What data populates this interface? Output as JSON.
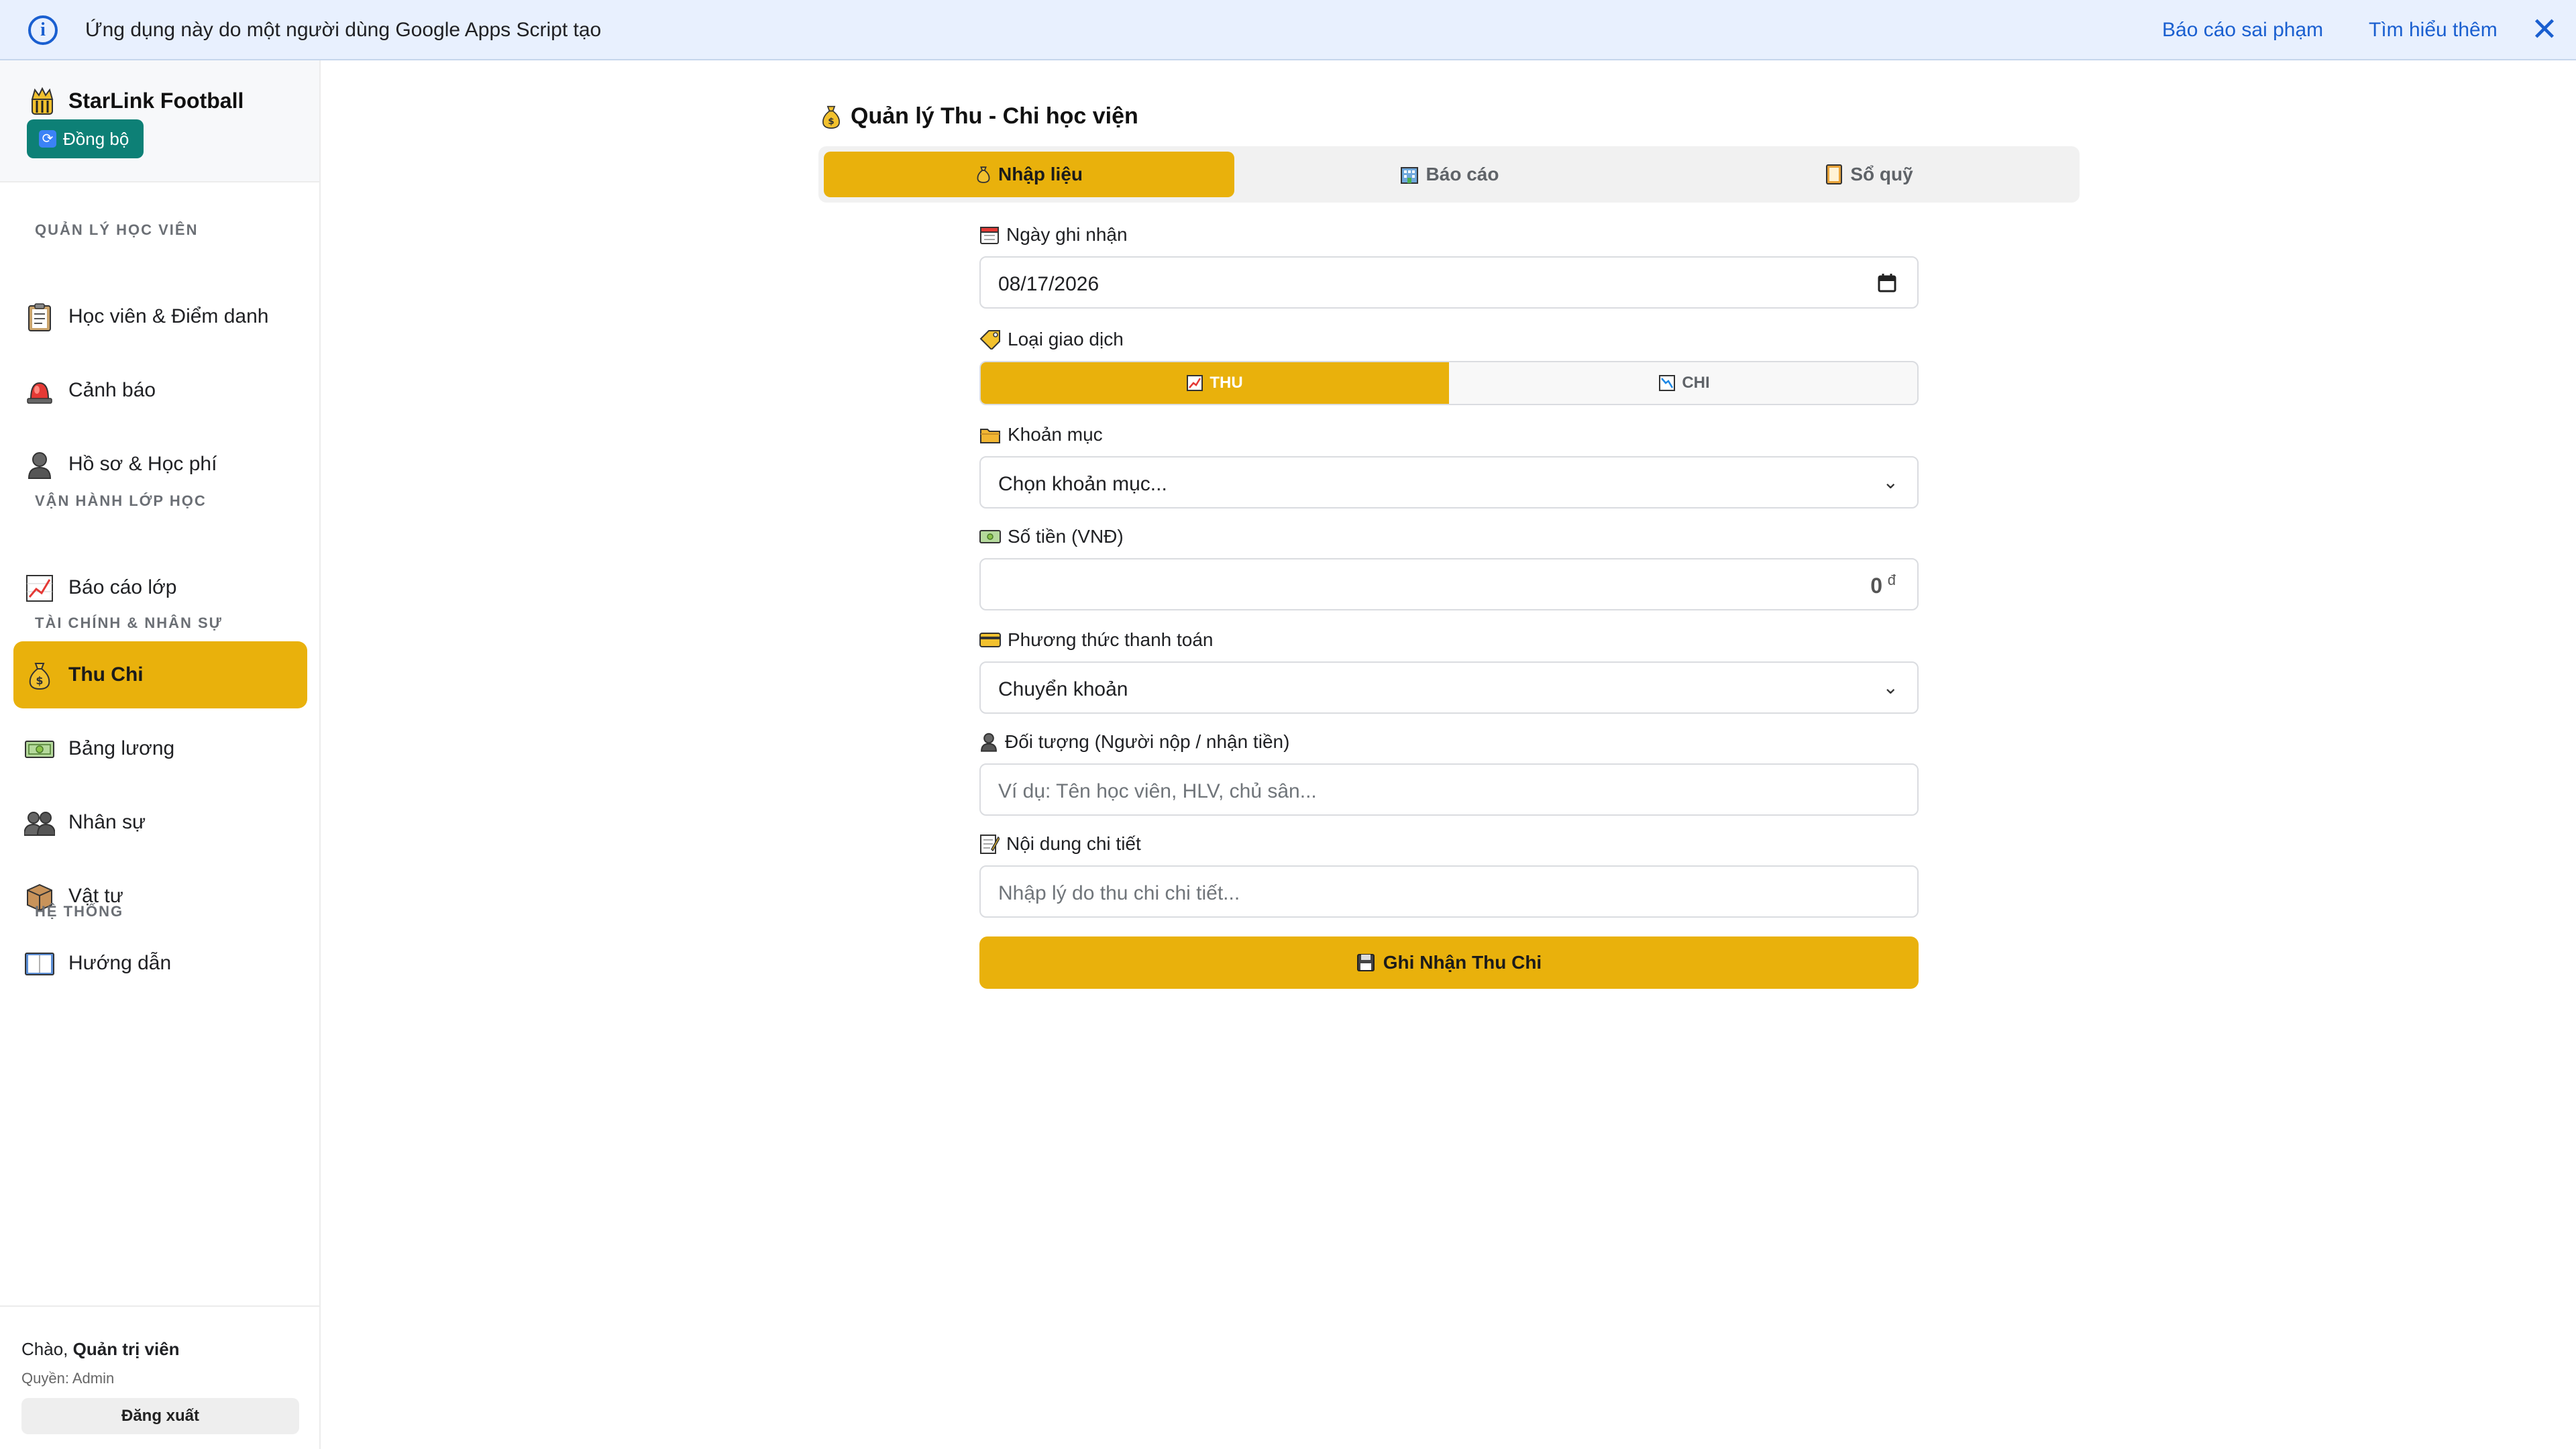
{
  "banner": {
    "text": "Ứng dụng này do một người dùng Google Apps Script tạo",
    "report_link": "Báo cáo sai phạm",
    "learn_link": "Tìm hiểu thêm",
    "info_glyph": "i",
    "close_glyph": "✕"
  },
  "sidebar": {
    "brand_name": "StarLink Football",
    "sync_label": "Đồng bộ",
    "sections": {
      "students": "QUẢN LÝ HỌC VIÊN",
      "operations": "VẬN HÀNH LỚP HỌC",
      "finance": "TÀI CHÍNH & NHÂN SỰ",
      "system": "HỆ THỐNG"
    },
    "items": [
      {
        "label": "Học viên & Điểm danh",
        "icon": "clipboard-icon"
      },
      {
        "label": "Cảnh báo",
        "icon": "siren-icon"
      },
      {
        "label": "Hồ sơ & Học phí",
        "icon": "user-icon"
      },
      {
        "label": "Báo cáo lớp",
        "icon": "chart-up-icon"
      },
      {
        "label": "Thu Chi",
        "icon": "money-bag-icon",
        "active": true
      },
      {
        "label": "Bảng lương",
        "icon": "cash-icon"
      },
      {
        "label": "Nhân sự",
        "icon": "users-icon"
      },
      {
        "label": "Vật tư",
        "icon": "box-icon"
      },
      {
        "label": "Hướng dẫn",
        "icon": "book-icon"
      }
    ],
    "user": {
      "greeting_prefix": "Chào,",
      "name": "Quản trị viên",
      "role": "Quyền: Admin",
      "logout_label": "Đăng xuất"
    }
  },
  "main": {
    "title": "Quản lý Thu - Chi học viện",
    "tabs": [
      {
        "label": "Nhập liệu",
        "active": true
      },
      {
        "label": "Báo cáo",
        "active": false
      },
      {
        "label": "Sổ quỹ",
        "active": false
      }
    ],
    "form": {
      "date_label": "Ngày ghi nhận",
      "date_value": "08/17/2026",
      "type_label": "Loại giao dịch",
      "type_options": [
        {
          "label": "THU",
          "active": true
        },
        {
          "label": "CHI",
          "active": false
        }
      ],
      "category_label": "Khoản mục",
      "category_value": "Chọn khoản mục...",
      "amount_label": "Số tiền (VNĐ)",
      "amount_value": "0",
      "currency_symbol": "đ",
      "method_label": "Phương thức thanh toán",
      "method_value": "Chuyển khoản",
      "party_label": "Đối tượng (Người nộp / nhận tiền)",
      "party_placeholder": "Ví dụ: Tên học viên, HLV, chủ sân...",
      "detail_label": "Nội dung chi tiết",
      "detail_placeholder": "Nhập lý do thu chi chi tiết...",
      "submit_label": "Ghi Nhận Thu Chi"
    }
  },
  "colors": {
    "accent": "#e9b10c",
    "sync_button": "#0d8076",
    "banner_bg": "#e8f0fe",
    "link": "#1a5fd0"
  }
}
